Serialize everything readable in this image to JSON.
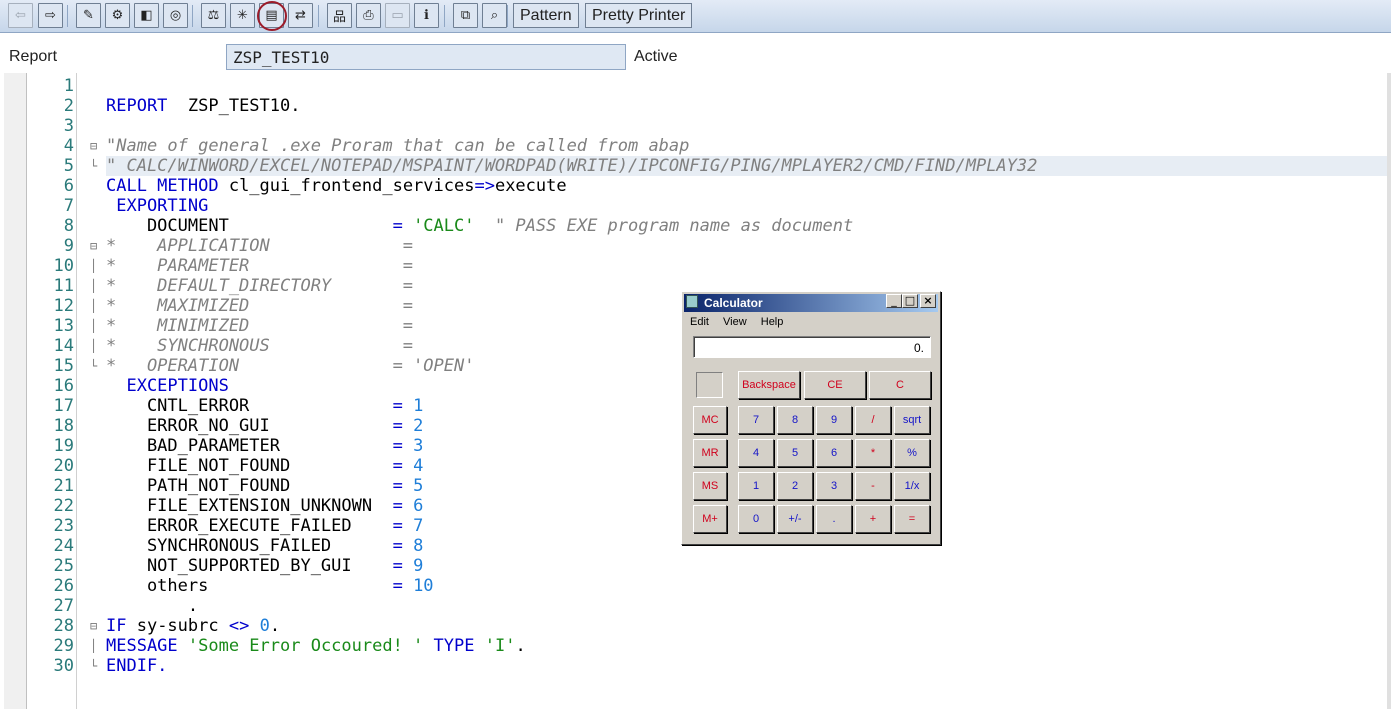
{
  "toolbar": {
    "buttons": [
      {
        "icon": "back-arrow-icon",
        "glyph": "⇦",
        "enabled": false
      },
      {
        "icon": "forward-arrow-icon",
        "glyph": "⇨",
        "enabled": true
      },
      {
        "icon": "syntax-check-icon",
        "glyph": "✎",
        "enabled": true
      },
      {
        "icon": "display-objects-icon",
        "glyph": "⚙",
        "enabled": true
      },
      {
        "icon": "activate-icon",
        "glyph": "◧",
        "enabled": true
      },
      {
        "icon": "test-icon",
        "glyph": "◎",
        "enabled": true
      },
      {
        "icon": "where-used-icon",
        "glyph": "⚖",
        "enabled": true
      },
      {
        "icon": "object-list-icon",
        "glyph": "✳",
        "enabled": true
      },
      {
        "icon": "navigation-window-icon",
        "glyph": "▤",
        "enabled": true
      },
      {
        "icon": "display-navigation-icon",
        "glyph": "⇄",
        "enabled": true
      },
      {
        "icon": "hierarchy-icon",
        "glyph": "品",
        "enabled": true
      },
      {
        "icon": "print-icon",
        "glyph": "⎙",
        "enabled": true
      },
      {
        "icon": "disabled-field-icon",
        "glyph": "▭",
        "enabled": false
      },
      {
        "icon": "info-icon",
        "glyph": "ℹ",
        "enabled": true
      },
      {
        "icon": "copy-icon",
        "glyph": "⧉",
        "enabled": true
      },
      {
        "icon": "find-icon",
        "glyph": "⌕",
        "enabled": true
      }
    ],
    "pattern_label": "Pattern",
    "pretty_printer_label": "Pretty Printer"
  },
  "header": {
    "label": "Report",
    "program_name": "ZSP_TEST10",
    "status": "Active"
  },
  "code_lines": [
    {
      "n": "1",
      "fold": "",
      "tokens": []
    },
    {
      "n": "2",
      "fold": "",
      "tokens": [
        {
          "t": "REPORT",
          "c": "kw"
        },
        {
          "t": "  ZSP_TEST10.",
          "c": "id"
        }
      ]
    },
    {
      "n": "3",
      "fold": "",
      "tokens": []
    },
    {
      "n": "4",
      "fold": "⊟",
      "tokens": [
        {
          "t": "\"Name of general .exe Proram that can be called from abap",
          "c": "cmt"
        }
      ]
    },
    {
      "n": "5",
      "fold": "└",
      "hl": true,
      "tokens": [
        {
          "t": "\" CALC/WINWORD/EXCEL/NOTEPAD/MSPAINT/WORDPAD(WRITE)/IPCONFIG/PING/MPLAYER2/CMD/FIND/MPLAY32",
          "c": "cmt"
        }
      ]
    },
    {
      "n": "6",
      "fold": "",
      "tokens": [
        {
          "t": "CALL METHOD",
          "c": "kw"
        },
        {
          "t": " cl_gui_frontend_services",
          "c": "id"
        },
        {
          "t": "=>",
          "c": "kw"
        },
        {
          "t": "execute",
          "c": "id"
        }
      ]
    },
    {
      "n": "7",
      "fold": "",
      "tokens": [
        {
          "t": " EXPORTING",
          "c": "kw"
        }
      ]
    },
    {
      "n": "8",
      "fold": "",
      "tokens": [
        {
          "t": "    DOCUMENT                ",
          "c": "id"
        },
        {
          "t": "= ",
          "c": "kw"
        },
        {
          "t": "'CALC'",
          "c": "str"
        },
        {
          "t": "  \" PASS EXE program name as document",
          "c": "cmt"
        }
      ]
    },
    {
      "n": "9",
      "fold": "⊟",
      "tokens": [
        {
          "t": "*    APPLICATION             =",
          "c": "cmt"
        }
      ]
    },
    {
      "n": "10",
      "fold": "│",
      "tokens": [
        {
          "t": "*    PARAMETER               =",
          "c": "cmt"
        }
      ]
    },
    {
      "n": "11",
      "fold": "│",
      "tokens": [
        {
          "t": "*    DEFAULT_DIRECTORY       =",
          "c": "cmt"
        }
      ]
    },
    {
      "n": "12",
      "fold": "│",
      "tokens": [
        {
          "t": "*    MAXIMIZED               =",
          "c": "cmt"
        }
      ]
    },
    {
      "n": "13",
      "fold": "│",
      "tokens": [
        {
          "t": "*    MINIMIZED               =",
          "c": "cmt"
        }
      ]
    },
    {
      "n": "14",
      "fold": "│",
      "tokens": [
        {
          "t": "*    SYNCHRONOUS             =",
          "c": "cmt"
        }
      ]
    },
    {
      "n": "15",
      "fold": "└",
      "tokens": [
        {
          "t": "*   OPERATION               = 'OPEN'",
          "c": "cmt"
        }
      ]
    },
    {
      "n": "16",
      "fold": "",
      "tokens": [
        {
          "t": "  EXCEPTIONS",
          "c": "kw"
        }
      ]
    },
    {
      "n": "17",
      "fold": "",
      "tokens": [
        {
          "t": "    CNTL_ERROR              ",
          "c": "id"
        },
        {
          "t": "= ",
          "c": "kw"
        },
        {
          "t": "1",
          "c": "num"
        }
      ]
    },
    {
      "n": "18",
      "fold": "",
      "tokens": [
        {
          "t": "    ERROR_NO_GUI            ",
          "c": "id"
        },
        {
          "t": "= ",
          "c": "kw"
        },
        {
          "t": "2",
          "c": "num"
        }
      ]
    },
    {
      "n": "19",
      "fold": "",
      "tokens": [
        {
          "t": "    BAD_PARAMETER           ",
          "c": "id"
        },
        {
          "t": "= ",
          "c": "kw"
        },
        {
          "t": "3",
          "c": "num"
        }
      ]
    },
    {
      "n": "20",
      "fold": "",
      "tokens": [
        {
          "t": "    FILE_NOT_FOUND          ",
          "c": "id"
        },
        {
          "t": "= ",
          "c": "kw"
        },
        {
          "t": "4",
          "c": "num"
        }
      ]
    },
    {
      "n": "21",
      "fold": "",
      "tokens": [
        {
          "t": "    PATH_NOT_FOUND          ",
          "c": "id"
        },
        {
          "t": "= ",
          "c": "kw"
        },
        {
          "t": "5",
          "c": "num"
        }
      ]
    },
    {
      "n": "22",
      "fold": "",
      "tokens": [
        {
          "t": "    FILE_EXTENSION_UNKNOWN  ",
          "c": "id"
        },
        {
          "t": "= ",
          "c": "kw"
        },
        {
          "t": "6",
          "c": "num"
        }
      ]
    },
    {
      "n": "23",
      "fold": "",
      "tokens": [
        {
          "t": "    ERROR_EXECUTE_FAILED    ",
          "c": "id"
        },
        {
          "t": "= ",
          "c": "kw"
        },
        {
          "t": "7",
          "c": "num"
        }
      ]
    },
    {
      "n": "24",
      "fold": "",
      "tokens": [
        {
          "t": "    SYNCHRONOUS_FAILED      ",
          "c": "id"
        },
        {
          "t": "= ",
          "c": "kw"
        },
        {
          "t": "8",
          "c": "num"
        }
      ]
    },
    {
      "n": "25",
      "fold": "",
      "tokens": [
        {
          "t": "    NOT_SUPPORTED_BY_GUI    ",
          "c": "id"
        },
        {
          "t": "= ",
          "c": "kw"
        },
        {
          "t": "9",
          "c": "num"
        }
      ]
    },
    {
      "n": "26",
      "fold": "",
      "tokens": [
        {
          "t": "    others                  ",
          "c": "id"
        },
        {
          "t": "= ",
          "c": "kw"
        },
        {
          "t": "10",
          "c": "num"
        }
      ]
    },
    {
      "n": "27",
      "fold": "",
      "tokens": [
        {
          "t": "        .",
          "c": "id"
        }
      ]
    },
    {
      "n": "28",
      "fold": "⊟",
      "tokens": [
        {
          "t": "IF",
          "c": "kw"
        },
        {
          "t": " sy-subrc ",
          "c": "id"
        },
        {
          "t": "<>",
          "c": "kw"
        },
        {
          "t": " 0",
          "c": "num"
        },
        {
          "t": ".",
          "c": "id"
        }
      ]
    },
    {
      "n": "29",
      "fold": "│",
      "tokens": [
        {
          "t": "MESSAGE",
          "c": "kw"
        },
        {
          "t": " 'Some Error Occoured! '",
          "c": "str"
        },
        {
          "t": " TYPE",
          "c": "kw"
        },
        {
          "t": " 'I'",
          "c": "str"
        },
        {
          "t": ".",
          "c": "id"
        }
      ]
    },
    {
      "n": "30",
      "fold": "└",
      "tokens": [
        {
          "t": "ENDIF.",
          "c": "kw"
        }
      ]
    }
  ],
  "calculator": {
    "title": "Calculator",
    "menu": [
      "Edit",
      "View",
      "Help"
    ],
    "display": "0.",
    "caption_buttons": [
      "_",
      "□",
      "×"
    ],
    "top_buttons": [
      "Backspace",
      "CE",
      "C"
    ],
    "memory_buttons": [
      "MC",
      "MR",
      "MS",
      "M+"
    ],
    "grid": [
      [
        "7",
        "8",
        "9",
        "/",
        "sqrt"
      ],
      [
        "4",
        "5",
        "6",
        "*",
        "%"
      ],
      [
        "1",
        "2",
        "3",
        "-",
        "1/x"
      ],
      [
        "0",
        "+/-",
        ".",
        "+",
        "="
      ]
    ]
  }
}
